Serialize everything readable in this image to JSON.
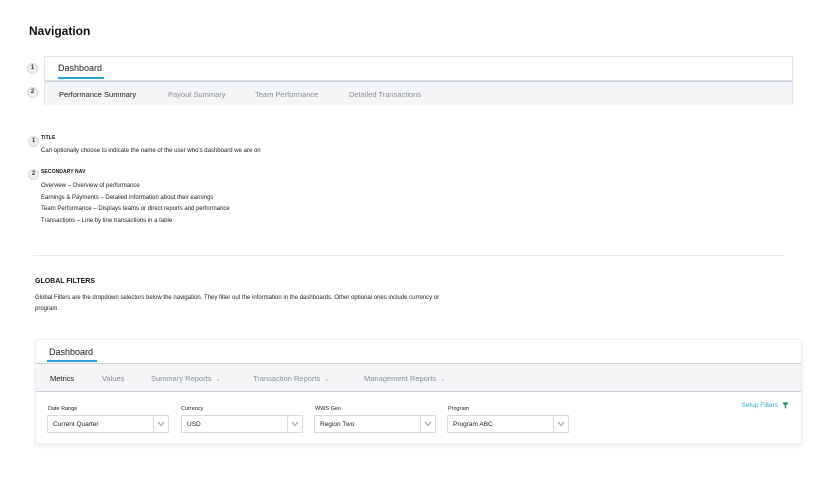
{
  "page": {
    "title": "Navigation"
  },
  "badges": [
    "1",
    "2"
  ],
  "nav": {
    "title": "Dashboard",
    "tabs": [
      {
        "label": "Performance Summary",
        "active": true
      },
      {
        "label": "Payout Summary",
        "active": false
      },
      {
        "label": "Team Performance",
        "active": false
      },
      {
        "label": "Detailed Transactions",
        "active": false
      }
    ]
  },
  "notes": {
    "title": {
      "heading": "TITLE",
      "text": "Can optionally choose to indicate the name of the user who's dashboard we are on"
    },
    "secondary_nav": {
      "heading": "SECONDARY NAV",
      "lines": [
        "Overview – Overview of performance",
        "Earnings & Payments – Detailed information about their earnings",
        "Team Performance – Displays teams or direct reports and performance",
        "Transactions – Line by line transactions in a table"
      ]
    }
  },
  "global_filters": {
    "heading": "GLOBAL FILTERS",
    "description": "Global Filters are the dropdown selectors below the navigation. They filter out the information in the dashboards. Other optional ones include currency or program."
  },
  "dashboard": {
    "title": "Dashboard",
    "tabs": [
      {
        "label": "Metrics",
        "active": true,
        "dropdown": false
      },
      {
        "label": "Values",
        "active": false,
        "dropdown": false
      },
      {
        "label": "Summary Reports",
        "active": false,
        "dropdown": true
      },
      {
        "label": "Transaction Reports",
        "active": false,
        "dropdown": true
      },
      {
        "label": "Management Reports",
        "active": false,
        "dropdown": true
      }
    ],
    "filters": [
      {
        "label": "Date Range",
        "value": "Current Quarter"
      },
      {
        "label": "Currency",
        "value": "USD"
      },
      {
        "label": "WWS Geo",
        "value": "Region Two"
      },
      {
        "label": "Program",
        "value": "Program ABC"
      }
    ],
    "setup_filters_label": "Setup Filters",
    "accent_color": "#2f9fd8",
    "link_color": "#2ea7c9",
    "icons": {
      "filter": "filter-icon",
      "dropdown": "chevron-down-icon"
    }
  }
}
